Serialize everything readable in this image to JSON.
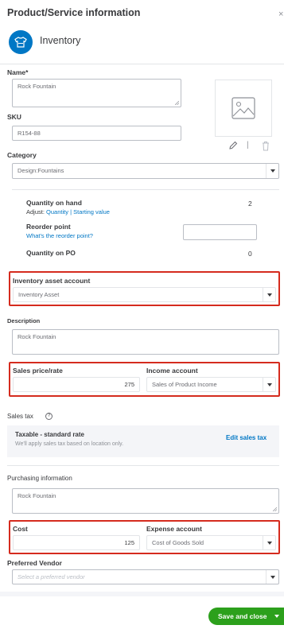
{
  "header": {
    "title": "Product/Service information",
    "close": "×"
  },
  "item_type": {
    "label": "Inventory",
    "icon": "shirt-icon"
  },
  "name": {
    "label": "Name*",
    "value": "Rock Fountain"
  },
  "sku": {
    "label": "SKU",
    "value": "R154-88"
  },
  "category": {
    "label": "Category",
    "value": "Design:Fountains"
  },
  "quantity_on_hand": {
    "label": "Quantity on hand",
    "value": "2",
    "adjust_prefix": "Adjust:",
    "adjust_quantity": "Quantity",
    "separator": "|",
    "starting_value": "Starting value"
  },
  "reorder": {
    "label": "Reorder point",
    "help_link": "What's the reorder point?",
    "value": ""
  },
  "quantity_on_po": {
    "label": "Quantity on PO",
    "value": "0"
  },
  "inventory_asset": {
    "label": "Inventory asset account",
    "value": "Inventory Asset"
  },
  "description": {
    "label": "Description",
    "value": "Rock Fountain"
  },
  "sales_price": {
    "label": "Sales price/rate",
    "value": "275"
  },
  "income_account": {
    "label": "Income account",
    "value": "Sales of Product Income"
  },
  "sales_tax": {
    "label": "Sales tax",
    "info_icon": "info-icon",
    "rate_label": "Taxable - standard rate",
    "note": "We'll apply sales tax based on location only.",
    "edit_link": "Edit sales tax"
  },
  "purchasing": {
    "label": "Purchasing information",
    "value": "Rock Fountain"
  },
  "cost": {
    "label": "Cost",
    "value": "125"
  },
  "expense_account": {
    "label": "Expense account",
    "value": "Cost of Goods Sold"
  },
  "vendor": {
    "label": "Preferred Vendor",
    "placeholder": "Select a preferred vendor"
  },
  "image_tools": {
    "edit_icon": "pencil-icon",
    "divider": "|",
    "delete_icon": "trash-icon"
  },
  "footer": {
    "save_label": "Save and close"
  },
  "colors": {
    "highlight": "#d52b1e",
    "accent": "#0077c5",
    "save": "#2ca01c"
  }
}
